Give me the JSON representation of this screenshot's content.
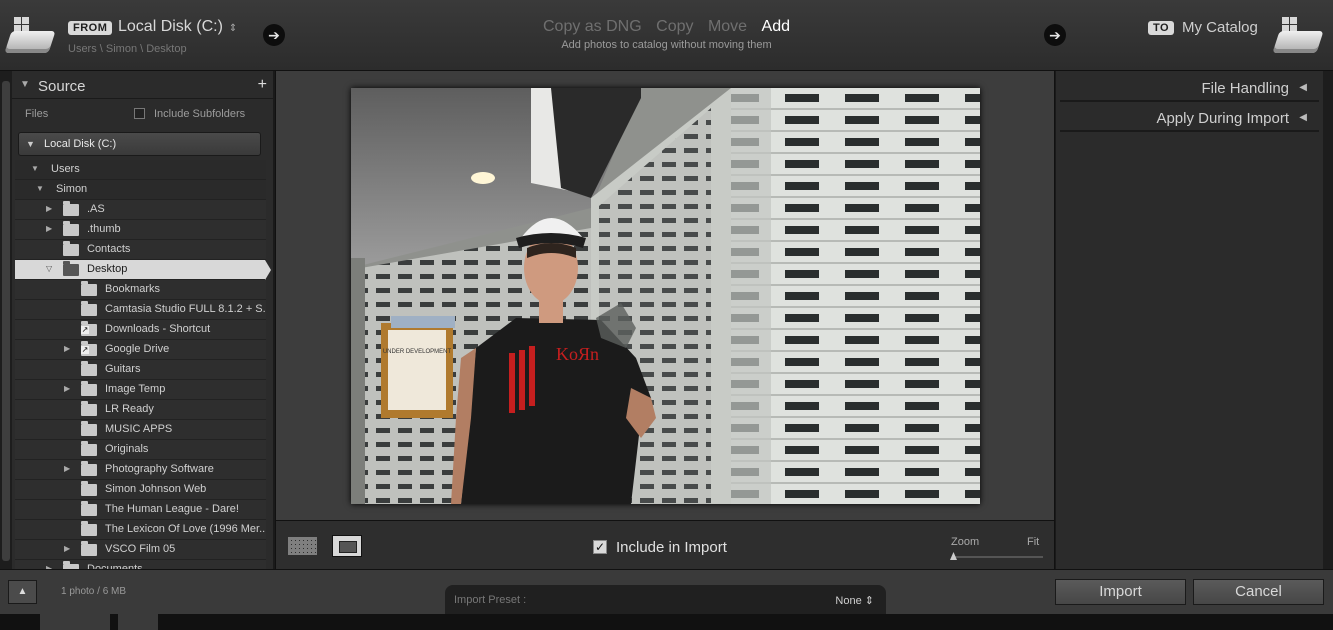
{
  "header": {
    "from_pill": "FROM",
    "source_name": "Local Disk (C:)",
    "source_updown": "⇕",
    "source_path": "Users \\ Simon \\ Desktop",
    "modes": [
      {
        "label": "Copy as DNG",
        "active": false
      },
      {
        "label": "Copy",
        "active": false
      },
      {
        "label": "Move",
        "active": false
      },
      {
        "label": "Add",
        "active": true
      }
    ],
    "mode_description": "Add photos to catalog without moving them",
    "to_pill": "TO",
    "dest_name": "My Catalog"
  },
  "source_panel": {
    "title": "Source",
    "files_label": "Files",
    "include_subfolders": "Include Subfolders",
    "volume": "Local Disk (C:)",
    "tree": [
      {
        "label": "Users",
        "depth": 0,
        "type": "header",
        "expander": "▼"
      },
      {
        "label": "Simon",
        "depth": 1,
        "type": "header",
        "expander": "▼"
      },
      {
        "label": ".AS",
        "depth": 2,
        "type": "folder",
        "expander": "▶"
      },
      {
        "label": ".thumb",
        "depth": 2,
        "type": "folder",
        "expander": "▶"
      },
      {
        "label": "Contacts",
        "depth": 2,
        "type": "folder",
        "expander": ""
      },
      {
        "label": "Desktop",
        "depth": 2,
        "type": "selected",
        "expander": "▽"
      },
      {
        "label": "Bookmarks",
        "depth": 3,
        "type": "folder",
        "expander": ""
      },
      {
        "label": "Camtasia Studio FULL 8.1.2 + S...",
        "depth": 3,
        "type": "folder",
        "expander": ""
      },
      {
        "label": "Downloads - Shortcut",
        "depth": 3,
        "type": "shortcut",
        "expander": ""
      },
      {
        "label": "Google Drive",
        "depth": 3,
        "type": "shortcut",
        "expander": "▶"
      },
      {
        "label": "Guitars",
        "depth": 3,
        "type": "folder",
        "expander": ""
      },
      {
        "label": "Image Temp",
        "depth": 3,
        "type": "folder",
        "expander": "▶"
      },
      {
        "label": "LR Ready",
        "depth": 3,
        "type": "folder",
        "expander": ""
      },
      {
        "label": "MUSIC APPS",
        "depth": 3,
        "type": "folder",
        "expander": ""
      },
      {
        "label": "Originals",
        "depth": 3,
        "type": "folder",
        "expander": ""
      },
      {
        "label": "Photography Software",
        "depth": 3,
        "type": "folder",
        "expander": "▶"
      },
      {
        "label": "Simon Johnson Web",
        "depth": 3,
        "type": "folder",
        "expander": ""
      },
      {
        "label": "The Human League - Dare!",
        "depth": 3,
        "type": "folder",
        "expander": ""
      },
      {
        "label": "The Lexicon Of Love (1996 Mer...",
        "depth": 3,
        "type": "folder",
        "expander": ""
      },
      {
        "label": "VSCO Film 05",
        "depth": 3,
        "type": "folder",
        "expander": "▶"
      },
      {
        "label": "Documents",
        "depth": 2,
        "type": "folder",
        "expander": "▶"
      }
    ]
  },
  "preview": {
    "include_label": "Include in Import",
    "include_checked": "✓",
    "zoom_label": "Zoom",
    "fit_label": "Fit",
    "zoom_level": 0,
    "photo": {
      "poster_text": "UNDER DEVELOPMENT",
      "shirt_text": "KoЯn"
    }
  },
  "right_panel": {
    "sections": [
      {
        "label": "File Handling",
        "arrow": "◀"
      },
      {
        "label": "Apply During Import",
        "arrow": "◀"
      }
    ]
  },
  "footer": {
    "panel_toggle": "▲",
    "count": "1 photo / 6 MB",
    "preset_label": "Import Preset :",
    "preset_value": "None ⇕",
    "import_label": "Import",
    "cancel_label": "Cancel"
  }
}
